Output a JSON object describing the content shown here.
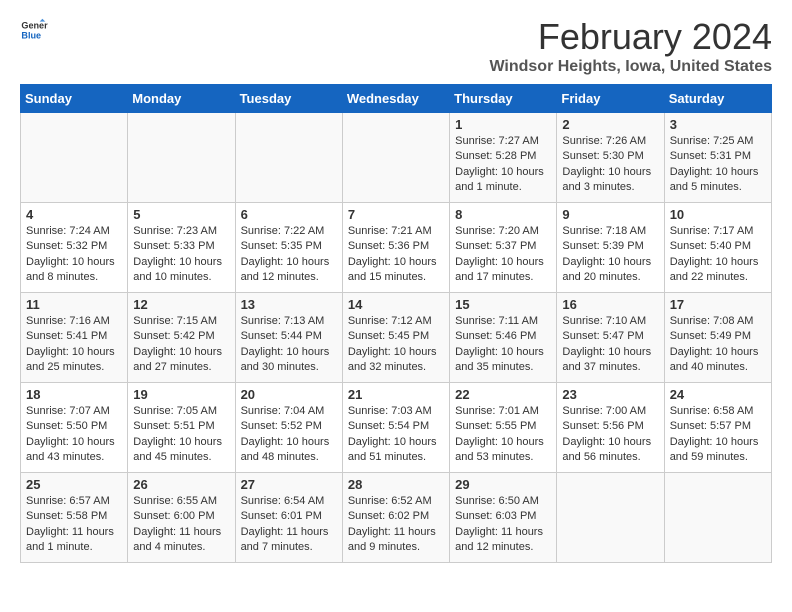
{
  "logo": {
    "general": "General",
    "blue": "Blue"
  },
  "title": "February 2024",
  "location": "Windsor Heights, Iowa, United States",
  "days_of_week": [
    "Sunday",
    "Monday",
    "Tuesday",
    "Wednesday",
    "Thursday",
    "Friday",
    "Saturday"
  ],
  "weeks": [
    [
      {
        "day": "",
        "info": ""
      },
      {
        "day": "",
        "info": ""
      },
      {
        "day": "",
        "info": ""
      },
      {
        "day": "",
        "info": ""
      },
      {
        "day": "1",
        "info": "Sunrise: 7:27 AM\nSunset: 5:28 PM\nDaylight: 10 hours\nand 1 minute."
      },
      {
        "day": "2",
        "info": "Sunrise: 7:26 AM\nSunset: 5:30 PM\nDaylight: 10 hours\nand 3 minutes."
      },
      {
        "day": "3",
        "info": "Sunrise: 7:25 AM\nSunset: 5:31 PM\nDaylight: 10 hours\nand 5 minutes."
      }
    ],
    [
      {
        "day": "4",
        "info": "Sunrise: 7:24 AM\nSunset: 5:32 PM\nDaylight: 10 hours\nand 8 minutes."
      },
      {
        "day": "5",
        "info": "Sunrise: 7:23 AM\nSunset: 5:33 PM\nDaylight: 10 hours\nand 10 minutes."
      },
      {
        "day": "6",
        "info": "Sunrise: 7:22 AM\nSunset: 5:35 PM\nDaylight: 10 hours\nand 12 minutes."
      },
      {
        "day": "7",
        "info": "Sunrise: 7:21 AM\nSunset: 5:36 PM\nDaylight: 10 hours\nand 15 minutes."
      },
      {
        "day": "8",
        "info": "Sunrise: 7:20 AM\nSunset: 5:37 PM\nDaylight: 10 hours\nand 17 minutes."
      },
      {
        "day": "9",
        "info": "Sunrise: 7:18 AM\nSunset: 5:39 PM\nDaylight: 10 hours\nand 20 minutes."
      },
      {
        "day": "10",
        "info": "Sunrise: 7:17 AM\nSunset: 5:40 PM\nDaylight: 10 hours\nand 22 minutes."
      }
    ],
    [
      {
        "day": "11",
        "info": "Sunrise: 7:16 AM\nSunset: 5:41 PM\nDaylight: 10 hours\nand 25 minutes."
      },
      {
        "day": "12",
        "info": "Sunrise: 7:15 AM\nSunset: 5:42 PM\nDaylight: 10 hours\nand 27 minutes."
      },
      {
        "day": "13",
        "info": "Sunrise: 7:13 AM\nSunset: 5:44 PM\nDaylight: 10 hours\nand 30 minutes."
      },
      {
        "day": "14",
        "info": "Sunrise: 7:12 AM\nSunset: 5:45 PM\nDaylight: 10 hours\nand 32 minutes."
      },
      {
        "day": "15",
        "info": "Sunrise: 7:11 AM\nSunset: 5:46 PM\nDaylight: 10 hours\nand 35 minutes."
      },
      {
        "day": "16",
        "info": "Sunrise: 7:10 AM\nSunset: 5:47 PM\nDaylight: 10 hours\nand 37 minutes."
      },
      {
        "day": "17",
        "info": "Sunrise: 7:08 AM\nSunset: 5:49 PM\nDaylight: 10 hours\nand 40 minutes."
      }
    ],
    [
      {
        "day": "18",
        "info": "Sunrise: 7:07 AM\nSunset: 5:50 PM\nDaylight: 10 hours\nand 43 minutes."
      },
      {
        "day": "19",
        "info": "Sunrise: 7:05 AM\nSunset: 5:51 PM\nDaylight: 10 hours\nand 45 minutes."
      },
      {
        "day": "20",
        "info": "Sunrise: 7:04 AM\nSunset: 5:52 PM\nDaylight: 10 hours\nand 48 minutes."
      },
      {
        "day": "21",
        "info": "Sunrise: 7:03 AM\nSunset: 5:54 PM\nDaylight: 10 hours\nand 51 minutes."
      },
      {
        "day": "22",
        "info": "Sunrise: 7:01 AM\nSunset: 5:55 PM\nDaylight: 10 hours\nand 53 minutes."
      },
      {
        "day": "23",
        "info": "Sunrise: 7:00 AM\nSunset: 5:56 PM\nDaylight: 10 hours\nand 56 minutes."
      },
      {
        "day": "24",
        "info": "Sunrise: 6:58 AM\nSunset: 5:57 PM\nDaylight: 10 hours\nand 59 minutes."
      }
    ],
    [
      {
        "day": "25",
        "info": "Sunrise: 6:57 AM\nSunset: 5:58 PM\nDaylight: 11 hours\nand 1 minute."
      },
      {
        "day": "26",
        "info": "Sunrise: 6:55 AM\nSunset: 6:00 PM\nDaylight: 11 hours\nand 4 minutes."
      },
      {
        "day": "27",
        "info": "Sunrise: 6:54 AM\nSunset: 6:01 PM\nDaylight: 11 hours\nand 7 minutes."
      },
      {
        "day": "28",
        "info": "Sunrise: 6:52 AM\nSunset: 6:02 PM\nDaylight: 11 hours\nand 9 minutes."
      },
      {
        "day": "29",
        "info": "Sunrise: 6:50 AM\nSunset: 6:03 PM\nDaylight: 11 hours\nand 12 minutes."
      },
      {
        "day": "",
        "info": ""
      },
      {
        "day": "",
        "info": ""
      }
    ]
  ]
}
